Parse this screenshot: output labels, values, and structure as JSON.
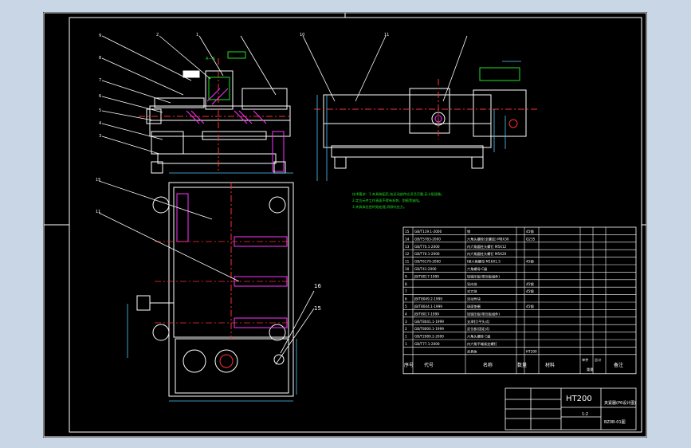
{
  "drawing": {
    "title_block": {
      "material_code": "HT200",
      "drawing_name": "夹紧器(P6设计图)",
      "drawing_no": "BZ0B-01图",
      "scale_text": "1:2"
    },
    "bom_headers": {
      "index": "序号",
      "code": "代号",
      "name": "名称",
      "qty": "数量",
      "material": "材料",
      "unit_weight": "单件",
      "total_weight": "总计",
      "weight": "重量",
      "note": "备注"
    },
    "bom_rows": [
      {
        "index": "15",
        "code": "GB/T119.1-2000",
        "name": "销",
        "qty": "",
        "material": "45钢",
        "note": ""
      },
      {
        "index": "14",
        "code": "GB/T5783-2000",
        "name": "六角头螺栓(全螺纹) M8X30",
        "qty": "",
        "material": "Q235",
        "note": ""
      },
      {
        "index": "13",
        "code": "GB/T70.1-2000",
        "name": "内六角圆柱头螺钉 M5X12",
        "qty": "",
        "material": "",
        "note": ""
      },
      {
        "index": "12",
        "code": "GB/T70.1-2000",
        "name": "内六角圆柱头螺钉 M5X20",
        "qty": "",
        "material": "",
        "note": ""
      },
      {
        "index": "11",
        "code": "GB/T6170-2000",
        "name": "I型六角螺母 M16X1.5",
        "qty": "",
        "material": "45钢",
        "note": ""
      },
      {
        "index": "10",
        "code": "GB/T41-2000",
        "name": "六角螺母-C级",
        "qty": "",
        "material": "",
        "note": ""
      },
      {
        "index": "9",
        "code": "JB/T8017-1999",
        "name": "铰链压板(带压板组件)",
        "qty": "",
        "material": "",
        "note": ""
      },
      {
        "index": "8",
        "code": "",
        "name": "导向块",
        "qty": "",
        "material": "45钢",
        "note": ""
      },
      {
        "index": "7",
        "code": "",
        "name": "对刀块",
        "qty": "",
        "material": "45钢",
        "note": ""
      },
      {
        "index": "6",
        "code": "JB/T8049.2-1999",
        "name": "活动导块",
        "qty": "",
        "material": "",
        "note": ""
      },
      {
        "index": "5",
        "code": "JB/T8044.1-1999",
        "name": "球面垫圈",
        "qty": "",
        "material": "45钢",
        "note": ""
      },
      {
        "index": "4",
        "code": "JB/T8017-1999",
        "name": "铰链压板(带压板组件)",
        "qty": "",
        "material": "",
        "note": ""
      },
      {
        "index": "3",
        "code": "GB/T8041.1-1999",
        "name": "支承钉(平头式)",
        "qty": "",
        "material": "",
        "note": ""
      },
      {
        "index": "2",
        "code": "GB/T8000.1-1999",
        "name": "定位板(固定式)",
        "qty": "",
        "material": "",
        "note": ""
      },
      {
        "index": "1",
        "code": "GB/T2089.2-2000",
        "name": "六角头螺栓 C级",
        "qty": "",
        "material": "",
        "note": ""
      },
      {
        "index": "1",
        "code": "GB/T77.1-2000",
        "name": "内六角平端紧定螺钉",
        "qty": "",
        "material": "",
        "note": ""
      },
      {
        "index": "",
        "code": "",
        "name": "夹具体",
        "qty": "",
        "material": "HT200",
        "note": ""
      }
    ],
    "technical_requirements": [
      "技术要求：1.夹具装配后,各运动部件应灵活可靠,无卡阻现象。",
      "2.定位元件工作表面不得有毛刺、划痕等缺陷。",
      "3.夹具体应经时效处理,消除内应力。"
    ],
    "view_labels": {
      "left_balloons": [
        "1",
        "2",
        "3",
        "4",
        "5",
        "6",
        "7",
        "8",
        "9"
      ],
      "right_balloons": [
        "10",
        "11"
      ],
      "plan_balloons": [
        "15",
        "11",
        "16",
        "15"
      ],
      "section_label": "A—A"
    },
    "colors": {
      "sheet": "#000000",
      "page": "#c9d6e6",
      "white_lines": "#ffffff",
      "green": "#22e022",
      "magenta": "#ff33ff",
      "red": "#ff3030",
      "yellow": "#e8e020",
      "cyan": "#50c8ff"
    }
  }
}
